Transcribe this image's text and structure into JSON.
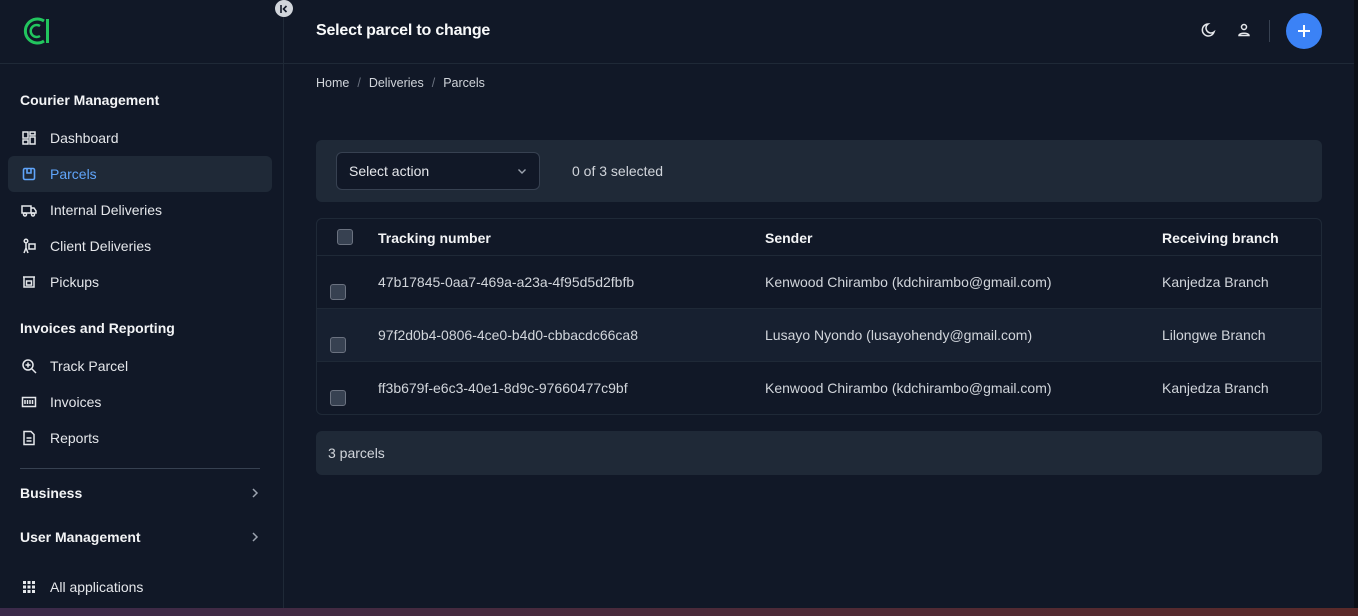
{
  "header": {
    "title": "Select parcel to change",
    "add_label": "+"
  },
  "breadcrumb": [
    "Home",
    "Deliveries",
    "Parcels"
  ],
  "sidebar": {
    "sections": [
      {
        "title": "Courier Management",
        "items": [
          {
            "label": "Dashboard",
            "icon": "dashboard-icon",
            "active": false
          },
          {
            "label": "Parcels",
            "icon": "parcel-icon",
            "active": true
          },
          {
            "label": "Internal Deliveries",
            "icon": "truck-icon",
            "active": false
          },
          {
            "label": "Client Deliveries",
            "icon": "person-carry-icon",
            "active": false
          },
          {
            "label": "Pickups",
            "icon": "pickup-icon",
            "active": false
          }
        ]
      },
      {
        "title": "Invoices and Reporting",
        "items": [
          {
            "label": "Track Parcel",
            "icon": "track-icon",
            "active": false
          },
          {
            "label": "Invoices",
            "icon": "invoice-icon",
            "active": false
          },
          {
            "label": "Reports",
            "icon": "report-icon",
            "active": false
          }
        ]
      }
    ],
    "groups": [
      {
        "label": "Business"
      },
      {
        "label": "User Management"
      }
    ],
    "all_apps": "All applications"
  },
  "actions": {
    "select_placeholder": "Select action",
    "selected_count": "0 of 3 selected"
  },
  "table": {
    "columns": [
      "Tracking number",
      "Sender",
      "Receiving branch"
    ],
    "rows": [
      {
        "tracking": "47b17845-0aa7-469a-a23a-4f95d5d2fbfb",
        "sender": "Kenwood Chirambo (kdchirambo@gmail.com)",
        "branch": "Kanjedza Branch"
      },
      {
        "tracking": "97f2d0b4-0806-4ce0-b4d0-cbbacdc66ca8",
        "sender": "Lusayo Nyondo (lusayohendy@gmail.com)",
        "branch": "Lilongwe Branch"
      },
      {
        "tracking": "ff3b679f-e6c3-40e1-8d9c-97660477c9bf",
        "sender": "Kenwood Chirambo (kdchirambo@gmail.com)",
        "branch": "Kanjedza Branch"
      }
    ]
  },
  "footer": {
    "count": "3 parcels"
  },
  "colors": {
    "accent": "#3b82f6",
    "active_text": "#60a5fa",
    "logo_green": "#22c55e"
  }
}
